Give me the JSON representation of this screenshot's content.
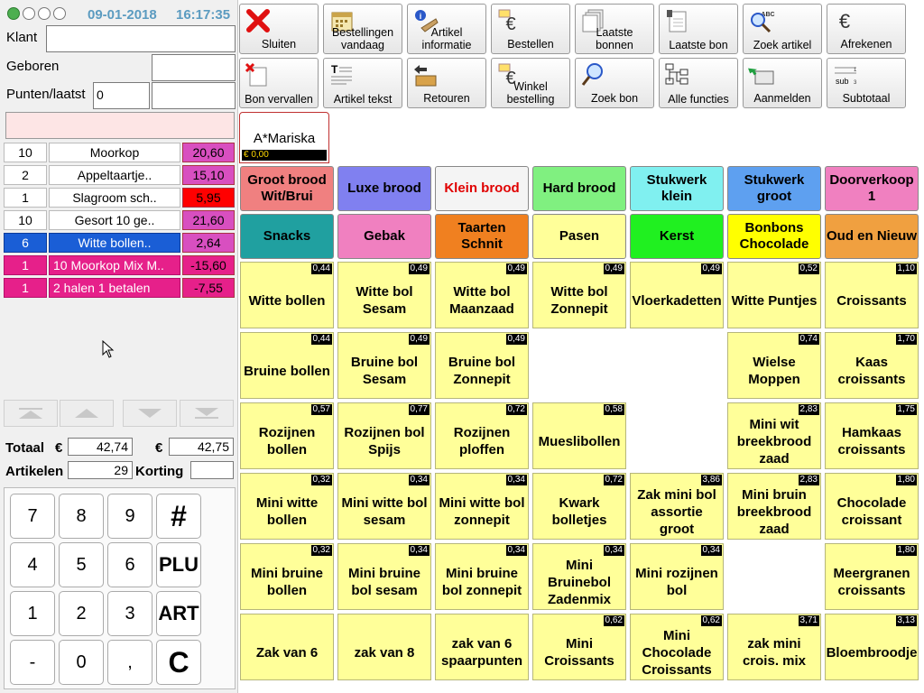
{
  "header": {
    "date": "09-01-2018",
    "time": "16:17:35"
  },
  "customer": {
    "klant_label": "Klant",
    "klant_value": "",
    "geboren_label": "Geboren",
    "geboren_value": "",
    "punten_label": "Punten/laatst",
    "punten_value": "0",
    "laatst_value": ""
  },
  "tickets": [
    {
      "qty": "10",
      "name": "Moorkop",
      "price": "20,60",
      "color": "#d84fc0",
      "state": "normal"
    },
    {
      "qty": "2",
      "name": "Appeltaartje..",
      "price": "15,10",
      "color": "#d84fc0",
      "state": "normal"
    },
    {
      "qty": "1",
      "name": "Slagroom sch..",
      "price": "5,95",
      "color": "#ff0000",
      "state": "normal"
    },
    {
      "qty": "10",
      "name": "Gesort 10 ge..",
      "price": "21,60",
      "color": "#d84fc0",
      "state": "normal"
    },
    {
      "qty": "6",
      "name": "Witte bollen..",
      "price": "2,64",
      "color": "#d84fc0",
      "state": "selected"
    },
    {
      "qty": "1",
      "name": "10 Moorkop Mix M..",
      "price": "-15,60",
      "color": "#e6208a",
      "state": "discount"
    },
    {
      "qty": "1",
      "name": "2 halen 1 betalen",
      "price": "-7,55",
      "color": "#e6208a",
      "state": "discount"
    }
  ],
  "totals": {
    "totaal_label": "Totaal",
    "euro": "€",
    "totaal_value": "42,74",
    "euro2": "€",
    "totaal2_value": "42,75",
    "artikelen_label": "Artikelen",
    "artikelen_value": "29",
    "korting_label": "Korting",
    "korting_value": ""
  },
  "numpad": [
    "7",
    "8",
    "9",
    "#",
    "4",
    "5",
    "6",
    "PLU",
    "1",
    "2",
    "3",
    "ART",
    "-",
    "0",
    ",",
    "C"
  ],
  "toolbar": [
    {
      "label": "Sluiten",
      "icon": "close-icon"
    },
    {
      "label": "Bestellingen vandaag",
      "icon": "calendar-icon"
    },
    {
      "label": "Artikel informatie",
      "icon": "info-icon"
    },
    {
      "label": "Bestellen",
      "icon": "euro-order-icon"
    },
    {
      "label": "Laatste bonnen",
      "icon": "receipts-icon"
    },
    {
      "label": "Laatste bon",
      "icon": "receipt-icon"
    },
    {
      "label": "Zoek artikel",
      "icon": "search-abc-icon"
    },
    {
      "label": "Afrekenen",
      "icon": "euro-icon"
    },
    {
      "label": "Bon vervallen",
      "icon": "void-receipt-icon"
    },
    {
      "label": "Artikel tekst",
      "icon": "text-icon"
    },
    {
      "label": "Retouren",
      "icon": "return-icon"
    },
    {
      "label": "Winkel bestelling",
      "icon": "shop-order-icon"
    },
    {
      "label": "Zoek bon",
      "icon": "magnifier-icon"
    },
    {
      "label": "Alle functies",
      "icon": "tree-icon"
    },
    {
      "label": "Aanmelden",
      "icon": "login-icon"
    },
    {
      "label": "Subtotaal",
      "icon": "subtotal-icon"
    }
  ],
  "employee": {
    "name": "A*Mariska",
    "amount": "€ 0,00"
  },
  "categories": [
    {
      "label": "Groot brood Wit/Brui",
      "bg": "#f08080",
      "fg": "#000000"
    },
    {
      "label": "Luxe brood",
      "bg": "#8080f0",
      "fg": "#000000"
    },
    {
      "label": "Klein brood",
      "bg": "#f4f4f4",
      "fg": "#e00000"
    },
    {
      "label": "Hard brood",
      "bg": "#80f080",
      "fg": "#000000"
    },
    {
      "label": "Stukwerk klein",
      "bg": "#80f0f0",
      "fg": "#000000"
    },
    {
      "label": "Stukwerk groot",
      "bg": "#5ea0f0",
      "fg": "#000000"
    },
    {
      "label": "Doorverkoop 1",
      "bg": "#f080c0",
      "fg": "#000000"
    },
    {
      "label": "Snacks",
      "bg": "#20a0a0",
      "fg": "#000000"
    },
    {
      "label": "Gebak",
      "bg": "#f080c0",
      "fg": "#000000"
    },
    {
      "label": "Taarten Schnit",
      "bg": "#f08020",
      "fg": "#000000"
    },
    {
      "label": "Pasen",
      "bg": "#ffff99",
      "fg": "#000000"
    },
    {
      "label": "Kerst",
      "bg": "#20f020",
      "fg": "#000000"
    },
    {
      "label": "Bonbons Chocolade",
      "bg": "#ffff00",
      "fg": "#000000"
    },
    {
      "label": "Oud en Nieuw",
      "bg": "#f0a040",
      "fg": "#000000"
    }
  ],
  "products": [
    {
      "name": "Witte bollen",
      "price": "0,44",
      "col": 0,
      "row": 0
    },
    {
      "name": "Witte bol Sesam",
      "price": "0,49",
      "col": 1,
      "row": 0
    },
    {
      "name": "Witte bol Maanzaad",
      "price": "0,49",
      "col": 2,
      "row": 0
    },
    {
      "name": "Witte bol Zonnepit",
      "price": "0,49",
      "col": 3,
      "row": 0
    },
    {
      "name": "Vloerkadetten",
      "price": "0,49",
      "col": 4,
      "row": 0
    },
    {
      "name": "Witte Puntjes",
      "price": "0,52",
      "col": 5,
      "row": 0
    },
    {
      "name": "Croissants",
      "price": "1,10",
      "col": 6,
      "row": 0
    },
    {
      "name": "Bruine bollen",
      "price": "0,44",
      "col": 0,
      "row": 1
    },
    {
      "name": "Bruine bol Sesam",
      "price": "0,49",
      "col": 1,
      "row": 1
    },
    {
      "name": "Bruine bol Zonnepit",
      "price": "0,49",
      "col": 2,
      "row": 1
    },
    {
      "name": "Wielse Moppen",
      "price": "0,74",
      "col": 5,
      "row": 1
    },
    {
      "name": "Kaas croissants",
      "price": "1,70",
      "col": 6,
      "row": 1
    },
    {
      "name": "Rozijnen bollen",
      "price": "0,57",
      "col": 0,
      "row": 2
    },
    {
      "name": "Rozijnen bol Spijs",
      "price": "0,77",
      "col": 1,
      "row": 2
    },
    {
      "name": "Rozijnen ploffen",
      "price": "0,72",
      "col": 2,
      "row": 2
    },
    {
      "name": "Mueslibollen",
      "price": "0,58",
      "col": 3,
      "row": 2
    },
    {
      "name": "Mini wit breekbrood zaad",
      "price": "2,83",
      "col": 5,
      "row": 2
    },
    {
      "name": "Hamkaas croissants",
      "price": "1,75",
      "col": 6,
      "row": 2
    },
    {
      "name": "Mini witte bollen",
      "price": "0,32",
      "col": 0,
      "row": 3
    },
    {
      "name": "Mini witte bol sesam",
      "price": "0,34",
      "col": 1,
      "row": 3
    },
    {
      "name": "Mini witte bol zonnepit",
      "price": "0,34",
      "col": 2,
      "row": 3
    },
    {
      "name": "Kwark bolletjes",
      "price": "0,72",
      "col": 3,
      "row": 3
    },
    {
      "name": "Zak mini bol assortie groot",
      "price": "3,86",
      "col": 4,
      "row": 3
    },
    {
      "name": "Mini bruin breekbrood zaad",
      "price": "2,83",
      "col": 5,
      "row": 3
    },
    {
      "name": "Chocolade croissant",
      "price": "1,80",
      "col": 6,
      "row": 3
    },
    {
      "name": "Mini bruine bollen",
      "price": "0,32",
      "col": 0,
      "row": 4
    },
    {
      "name": "Mini bruine bol sesam",
      "price": "0,34",
      "col": 1,
      "row": 4
    },
    {
      "name": "Mini bruine bol zonnepit",
      "price": "0,34",
      "col": 2,
      "row": 4
    },
    {
      "name": "Mini Bruinebol Zadenmix",
      "price": "0,34",
      "col": 3,
      "row": 4
    },
    {
      "name": "Mini rozijnen bol",
      "price": "0,34",
      "col": 4,
      "row": 4
    },
    {
      "name": "Meergranen croissants",
      "price": "1,80",
      "col": 6,
      "row": 4
    },
    {
      "name": "Zak van 6",
      "price": "",
      "col": 0,
      "row": 5
    },
    {
      "name": "zak van 8",
      "price": "",
      "col": 1,
      "row": 5
    },
    {
      "name": "zak van 6 spaarpunten",
      "price": "",
      "col": 2,
      "row": 5
    },
    {
      "name": "Mini Croissants",
      "price": "0,62",
      "col": 3,
      "row": 5
    },
    {
      "name": "Mini Chocolade Croissants",
      "price": "0,62",
      "col": 4,
      "row": 5
    },
    {
      "name": "zak mini crois. mix",
      "price": "3,71",
      "col": 5,
      "row": 5
    },
    {
      "name": "Bloembroodje",
      "price": "3,13",
      "col": 6,
      "row": 5
    }
  ]
}
